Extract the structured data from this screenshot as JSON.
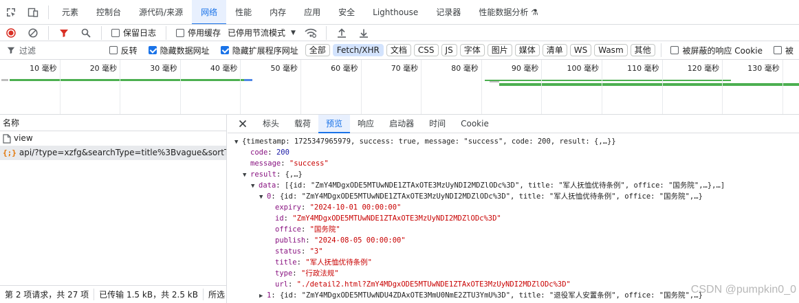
{
  "tabs": {
    "items": [
      {
        "label": "元素"
      },
      {
        "label": "控制台"
      },
      {
        "label": "源代码/来源"
      },
      {
        "label": "网络"
      },
      {
        "label": "性能"
      },
      {
        "label": "内存"
      },
      {
        "label": "应用"
      },
      {
        "label": "安全"
      },
      {
        "label": "Lighthouse"
      },
      {
        "label": "记录器"
      },
      {
        "label": "性能数据分析 ⚗"
      }
    ],
    "active_index": 3
  },
  "toolbar": {
    "preserve_log": "保留日志",
    "disable_cache": "停用缓存",
    "throttling": "已停用节流模式"
  },
  "filterbar": {
    "filter_placeholder": "过滤",
    "invert": "反转",
    "hide_data_urls": "隐藏数据网址",
    "hide_extension_urls": "隐藏扩展程序网址",
    "chips": [
      "全部",
      "Fetch/XHR",
      "文档",
      "CSS",
      "JS",
      "字体",
      "图片",
      "媒体",
      "清单",
      "WS",
      "Wasm",
      "其他"
    ],
    "active_chip": 1,
    "blocked_cookie": "被屏蔽的响应 Cookie",
    "more": "被"
  },
  "timeline": {
    "ticks": [
      "10 毫秒",
      "20 毫秒",
      "30 毫秒",
      "40 毫秒",
      "50 毫秒",
      "60 毫秒",
      "70 毫秒",
      "80 毫秒",
      "90 毫秒",
      "100 毫秒",
      "110 毫秒",
      "120 毫秒",
      "130 毫秒"
    ]
  },
  "requests": {
    "header": "名称",
    "items": [
      {
        "name": "view",
        "type": "doc"
      },
      {
        "name": "api/?type=xzfg&searchType=title%3Bvague&sortTr...",
        "type": "xhr"
      }
    ],
    "status": {
      "count": "第 2 项请求，共 27 项",
      "transferred": "已传输 1.5 kB，共 2.5 kB",
      "resources": "所选"
    }
  },
  "detail": {
    "tabs": [
      "标头",
      "载荷",
      "预览",
      "响应",
      "启动器",
      "时间",
      "Cookie"
    ],
    "active_index": 2,
    "lines": [
      {
        "indent": 0,
        "arrow": "▼",
        "text": "{timestamp: 1725347965979, success: true, message: \"success\", code: 200, result: {,…}}"
      },
      {
        "indent": 1,
        "arrow": "",
        "key": "code",
        "value": "200",
        "vtype": "n"
      },
      {
        "indent": 1,
        "arrow": "",
        "key": "message",
        "value": "\"success\"",
        "vtype": "s"
      },
      {
        "indent": 1,
        "arrow": "▼",
        "key": "result",
        "value": "{,…}",
        "vtype": "p"
      },
      {
        "indent": 2,
        "arrow": "▼",
        "key": "data",
        "value": "[{id: \"ZmY4MDgxODE5MTUwNDE1ZTAxOTE3MzUyNDI2MDZlODc%3D\", title: \"军人抚恤优待条例\", office: \"国务院\",…},…]",
        "vtype": "p"
      },
      {
        "indent": 3,
        "arrow": "▼",
        "key": "0",
        "value": "{id: \"ZmY4MDgxODE5MTUwNDE1ZTAxOTE3MzUyNDI2MDZlODc%3D\", title: \"军人抚恤优待条例\", office: \"国务院\",…}",
        "vtype": "p"
      },
      {
        "indent": 4,
        "arrow": "",
        "key": "expiry",
        "value": "\"2024-10-01 00:00:00\"",
        "vtype": "s"
      },
      {
        "indent": 4,
        "arrow": "",
        "key": "id",
        "value": "\"ZmY4MDgxODE5MTUwNDE1ZTAxOTE3MzUyNDI2MDZlODc%3D\"",
        "vtype": "s"
      },
      {
        "indent": 4,
        "arrow": "",
        "key": "office",
        "value": "\"国务院\"",
        "vtype": "s"
      },
      {
        "indent": 4,
        "arrow": "",
        "key": "publish",
        "value": "\"2024-08-05 00:00:00\"",
        "vtype": "s"
      },
      {
        "indent": 4,
        "arrow": "",
        "key": "status",
        "value": "\"3\"",
        "vtype": "s"
      },
      {
        "indent": 4,
        "arrow": "",
        "key": "title",
        "value": "\"军人抚恤优待条例\"",
        "vtype": "s"
      },
      {
        "indent": 4,
        "arrow": "",
        "key": "type",
        "value": "\"行政法规\"",
        "vtype": "s"
      },
      {
        "indent": 4,
        "arrow": "",
        "key": "url",
        "value": "\"./detail2.html?ZmY4MDgxODE5MTUwNDE1ZTAxOTE3MzUyNDI2MDZlODc%3D\"",
        "vtype": "s"
      },
      {
        "indent": 3,
        "arrow": "▶",
        "key": "1",
        "value": "{id: \"ZmY4MDgxODE5MTUwNDU4ZDAxOTE3MmU0NmE2ZTU3YmU%3D\", title: \"退役军人安置条例\", office: \"国务院\",…}",
        "vtype": "p"
      }
    ]
  },
  "watermark": "CSDN @pumpkin0_0",
  "colors": {
    "accent": "#1a73e8",
    "record": "#d93025",
    "filter": "#d93025",
    "key": "#881280",
    "string": "#c80000",
    "number": "#1a1aa6"
  }
}
